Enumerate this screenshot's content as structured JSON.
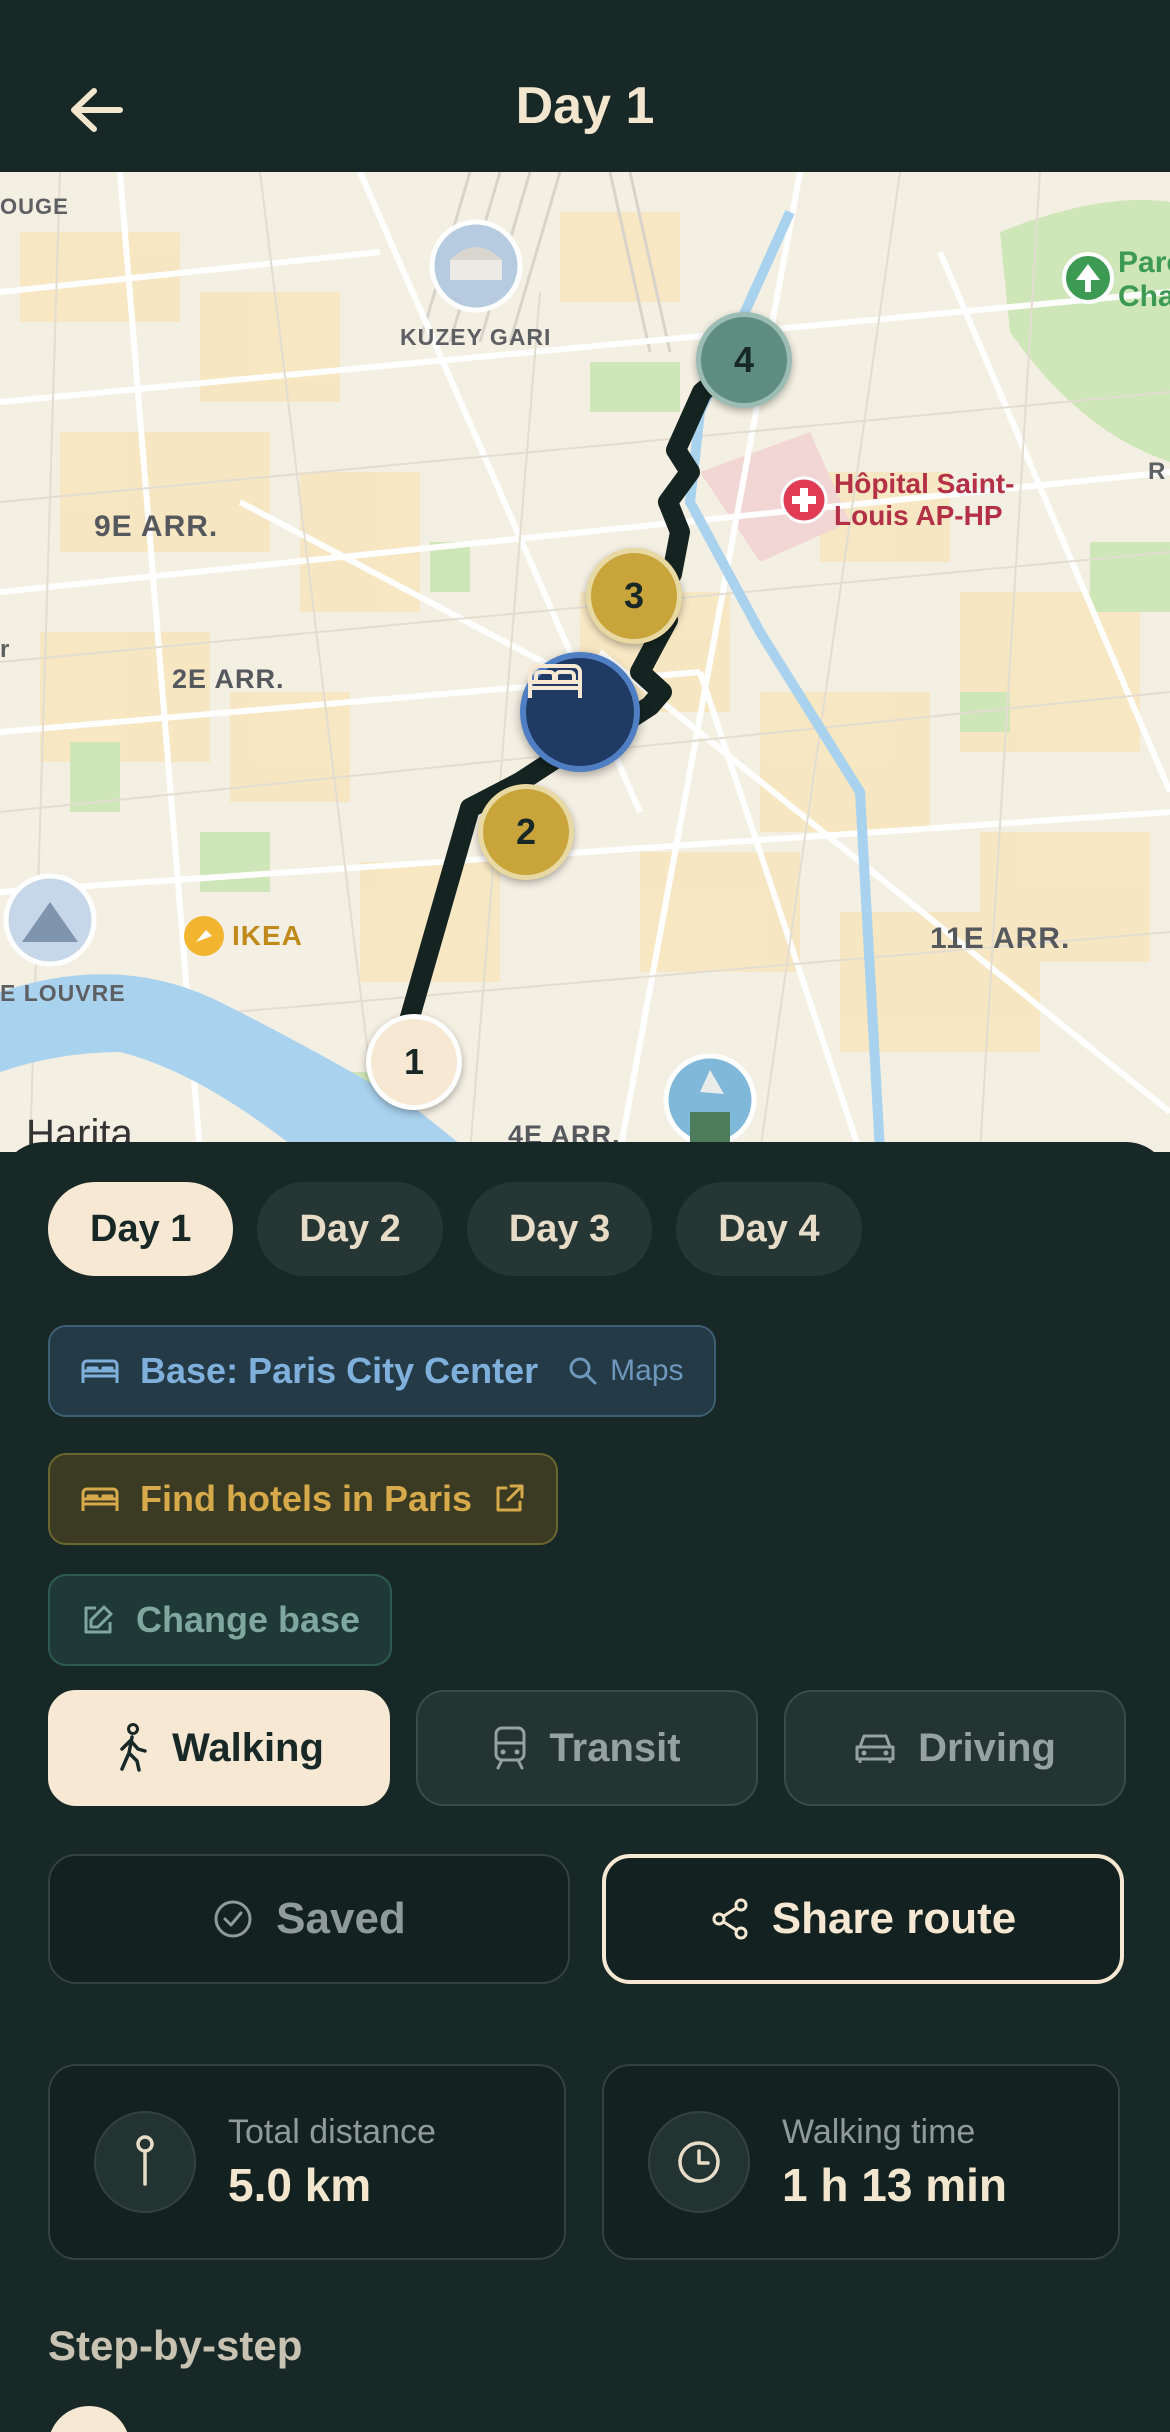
{
  "header": {
    "title": "Day 1",
    "back_icon": "arrow-left-icon"
  },
  "map": {
    "labels": {
      "kuzey_gari": "KUZEY GARI",
      "arr9": "9E ARR.",
      "arr2": "2E ARR.",
      "arr11": "11E ARR.",
      "arr4": "4E ARR.",
      "louvre": "E LOUVRE",
      "rouge": "OUGE",
      "ikea": "IKEA",
      "hopital_line1": "Hôpital Saint-",
      "hopital_line2": "Louis AP-HP",
      "parc_line1": "Parc",
      "parc_line2": "Cha",
      "harita": "Harita",
      "r_edge": "R",
      "r_edge_left": "r"
    },
    "markers": [
      {
        "label": "1",
        "kind": "start"
      },
      {
        "label": "2",
        "kind": "stop"
      },
      {
        "label": "3",
        "kind": "stop"
      },
      {
        "label": "4",
        "kind": "end"
      }
    ],
    "hotel_marker_icon": "bed-icon"
  },
  "days": [
    "Day 1",
    "Day 2",
    "Day 3",
    "Day 4"
  ],
  "active_day": "Day 1",
  "base": {
    "label": "Base: Paris City Center",
    "maps_label": "Maps",
    "icon": "bed-icon"
  },
  "hotels": {
    "label": "Find hotels in Paris",
    "icon": "bed-icon"
  },
  "change_base": {
    "label": "Change base",
    "icon": "edit-icon"
  },
  "modes": [
    {
      "label": "Walking",
      "icon": "walking-icon",
      "active": true
    },
    {
      "label": "Transit",
      "icon": "train-icon",
      "active": false
    },
    {
      "label": "Driving",
      "icon": "car-icon",
      "active": false
    }
  ],
  "actions": {
    "saved_label": "Saved",
    "share_label": "Share route"
  },
  "stats": {
    "distance": {
      "label": "Total distance",
      "value": "5.0 km",
      "icon": "pin-icon"
    },
    "time": {
      "label": "Walking time",
      "value": "1 h 13 min",
      "icon": "clock-icon"
    }
  },
  "steps_title": "Step-by-step",
  "colors": {
    "background": "#182826",
    "cream": "#f6e8d2",
    "marker_gold": "#c9a43a",
    "marker_teal": "#5e8c80",
    "hotel_navy": "#1f3a63",
    "base_blue": "#7fb0dc",
    "hotels_gold": "#d6a94a"
  }
}
